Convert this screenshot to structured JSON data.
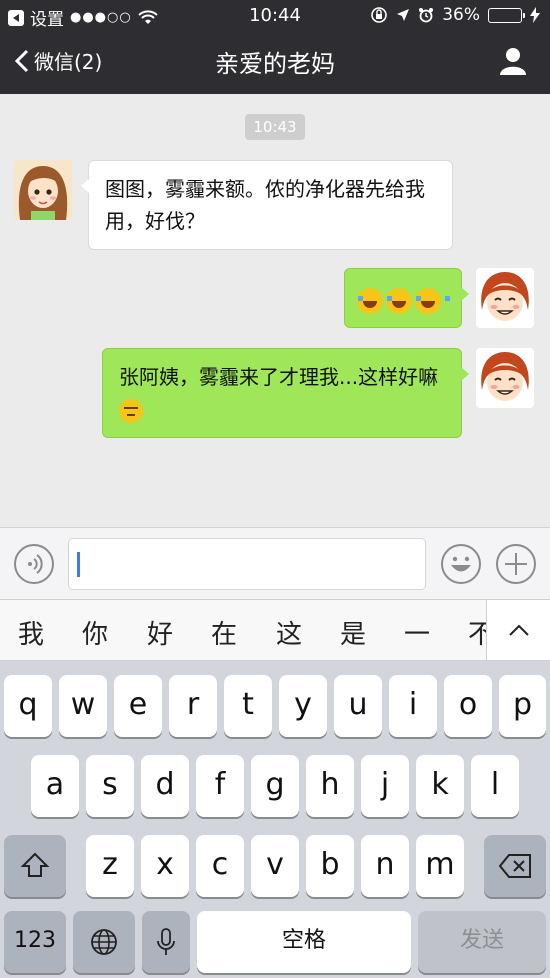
{
  "status": {
    "carrier": "设置",
    "time": "10:44",
    "battery": "36%",
    "battery_level": 0.36
  },
  "nav": {
    "back_label": "微信(2)",
    "title": "亲爱的老妈"
  },
  "chat": {
    "timestamp": "10:43",
    "messages": [
      {
        "side": "left",
        "text": "图图，雾霾来额。侬的净化器先给我用，好伐？"
      },
      {
        "side": "right",
        "emoji": [
          "face-with-tears-of-joy",
          "face-with-tears-of-joy",
          "face-with-tears-of-joy"
        ]
      },
      {
        "side": "right",
        "text": "张阿姨，雾霾来了才理我...这样好嘛",
        "emoji": "unamused-face"
      }
    ]
  },
  "input": {
    "value": "",
    "voice_icon": "voice-icon",
    "emoji_icon": "emoji-icon",
    "plus_icon": "plus-icon"
  },
  "candidates": [
    "我",
    "你",
    "好",
    "在",
    "这",
    "是",
    "一",
    "不"
  ],
  "keyboard": {
    "row1": [
      "q",
      "w",
      "e",
      "r",
      "t",
      "y",
      "u",
      "i",
      "o",
      "p"
    ],
    "row2": [
      "a",
      "s",
      "d",
      "f",
      "g",
      "h",
      "j",
      "k",
      "l"
    ],
    "row3": [
      "z",
      "x",
      "c",
      "v",
      "b",
      "n",
      "m"
    ],
    "num_label": "123",
    "space_label": "空格",
    "send_label": "发送"
  },
  "colors": {
    "nav_bg": "#2e2e32",
    "chat_bg": "#ebebeb",
    "bubble_right": "#9fe658",
    "bubble_left": "#ffffff",
    "battery_fill": "#f5c518",
    "caret": "#3d7be6"
  }
}
